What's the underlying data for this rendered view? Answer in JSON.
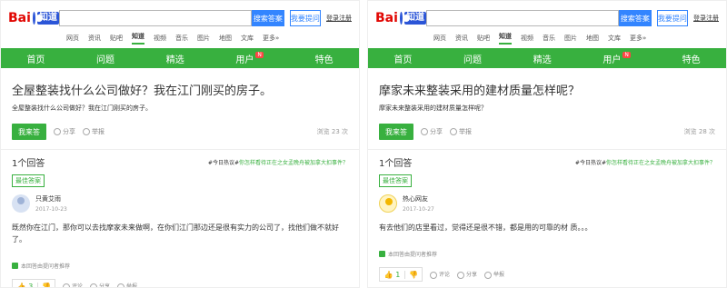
{
  "panels": [
    {
      "header": {
        "logo_text": "Bai",
        "logo_zd": "知道",
        "search_button": "搜索答案",
        "ask_button": "我要提问",
        "login": "登录注册"
      },
      "subnav": [
        "网页",
        "资讯",
        "贴吧",
        "知道",
        "视频",
        "音乐",
        "图片",
        "地图",
        "文库",
        "更多»"
      ],
      "greenbar": [
        "首页",
        "问题",
        "精选",
        "用户",
        "特色"
      ],
      "greenbar_badge": "N",
      "question": {
        "title": "全屋整装找什么公司做好？我在江门刚买的房子。",
        "desc": "全屋整装找什么公司做好？我在江门刚买的房子。",
        "answer_button": "我来答",
        "share": "分享",
        "report": "举报",
        "views": "浏览 23 次"
      },
      "answer_count": "1个回答",
      "hot_prefix": "#今日热议#",
      "hot_link": "你怎样看待正在之女孟晚舟被加拿大扣事件？",
      "best_label": "最佳答案",
      "answer": {
        "user": "只黄艾雨",
        "date": "2017-10-23",
        "text": "既然你在江门，那你可以去找摩家未来做啊，在你们江门那边还是很有实力的公司了，找他们做不就好了。",
        "note": "本回答由提问者推荐",
        "likes": "3",
        "comment": "评论",
        "share": "分享",
        "report": "举报"
      }
    },
    {
      "header": {
        "logo_text": "Bai",
        "logo_zd": "知道",
        "search_button": "搜索答案",
        "ask_button": "我要提问",
        "login": "登录注册"
      },
      "subnav": [
        "网页",
        "资讯",
        "贴吧",
        "知道",
        "视频",
        "音乐",
        "图片",
        "地图",
        "文库",
        "更多»"
      ],
      "greenbar": [
        "首页",
        "问题",
        "精选",
        "用户",
        "特色"
      ],
      "greenbar_badge": "N",
      "question": {
        "title": "摩家未来整装采用的建材质量怎样呢？",
        "desc": "摩家未来整装采用的建材质量怎样呢？",
        "answer_button": "我来答",
        "share": "分享",
        "report": "举报",
        "views": "浏览 28 次"
      },
      "answer_count": "1个回答",
      "hot_prefix": "#今日热议#",
      "hot_link": "你怎样看待正在之女孟晚舟被加拿大扣事件？",
      "best_label": "最佳答案",
      "answer": {
        "user": "热心网友",
        "date": "2017-10-27",
        "text": "有去他们的店里看过，觉得还是很不错，都是用的可靠的材 质。。。",
        "note": "本回答由提问者推荐",
        "likes": "1",
        "comment": "评论",
        "share": "分享",
        "report": "举报"
      }
    }
  ],
  "colors": {
    "accent_green": "#38b03f",
    "search_blue": "#3385ff",
    "logo_red": "#e10602"
  }
}
